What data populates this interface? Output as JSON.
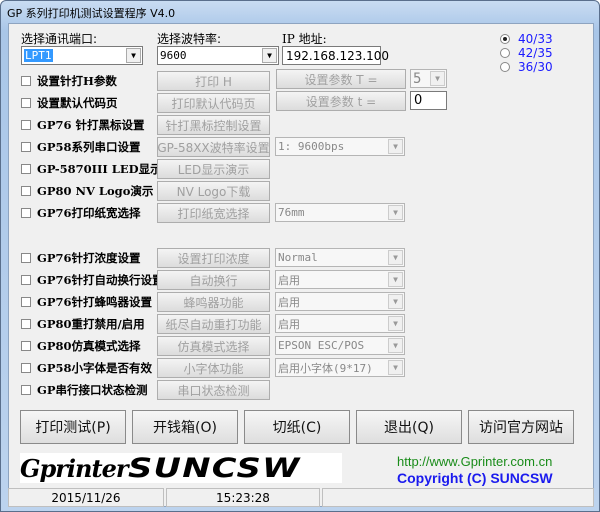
{
  "window": {
    "title": "GP 系列打印机测试设置程序 V4.0"
  },
  "top": {
    "port_label": "选择通讯端口:",
    "port_value": "LPT1",
    "baud_label": "选择波特率:",
    "baud_value": "9600",
    "ip_label": "IP 地址:",
    "ip_value": "192.168.123.100"
  },
  "radios": [
    {
      "label": "40/33",
      "selected": true
    },
    {
      "label": "42/35",
      "selected": false
    },
    {
      "label": "36/30",
      "selected": false
    }
  ],
  "param": {
    "T_button": "设置参数  T =",
    "T_value": "5",
    "t_button": "设置参数  t =",
    "t_value": "0"
  },
  "rows": [
    {
      "check": "设置针打H参数",
      "button": "打印 H"
    },
    {
      "check": "设置默认代码页",
      "button": "打印默认代码页"
    },
    {
      "check": "GP76 针打黑标设置",
      "button": "针打黑标控制设置"
    },
    {
      "check": "GP58系列串口设置",
      "button": "GP-58XX波特率设置",
      "combo": "1: 9600bps"
    },
    {
      "check": "GP-5870III LED显示",
      "button": "LED显示演示"
    },
    {
      "check": "GP80 NV Logo演示",
      "button": "NV Logo下载"
    },
    {
      "check": "GP76打印纸宽选择",
      "button": "打印纸宽选择",
      "combo": "76mm"
    },
    {
      "check": "GP76针打浓度设置",
      "button": "设置打印浓度",
      "combo": "Normal"
    },
    {
      "check": "GP76针打自动换行设置",
      "button": "自动换行",
      "combo": "启用"
    },
    {
      "check": "GP76针打蜂鸣器设置",
      "button": "蜂鸣器功能",
      "combo": "启用"
    },
    {
      "check": "GP80重打禁用/启用",
      "button": "纸尽自动重打功能",
      "combo": "启用"
    },
    {
      "check": "GP80仿真模式选择",
      "button": "仿真模式选择",
      "combo": "EPSON ESC/POS"
    },
    {
      "check": "GP58小字体是否有效",
      "button": "小字体功能",
      "combo": "启用小字体(9*17)"
    },
    {
      "check": "GP串行接口状态检测",
      "button": "串口状态检测"
    }
  ],
  "bottom_buttons": [
    "打印测试(P)",
    "开钱箱(O)",
    "切纸(C)",
    "退出(Q)",
    "访问官方网站"
  ],
  "logo": {
    "text1": "Gprinter",
    "text2": "SUNCSW"
  },
  "footer": {
    "url": "http://www.Gprinter.com.cn",
    "copyright": "Copyright (C) SUNCSW",
    "url_color": "#1a8c1a",
    "copyright_color": "#1a1aee"
  },
  "status": {
    "date": "2015/11/26",
    "time": "15:23:28"
  }
}
